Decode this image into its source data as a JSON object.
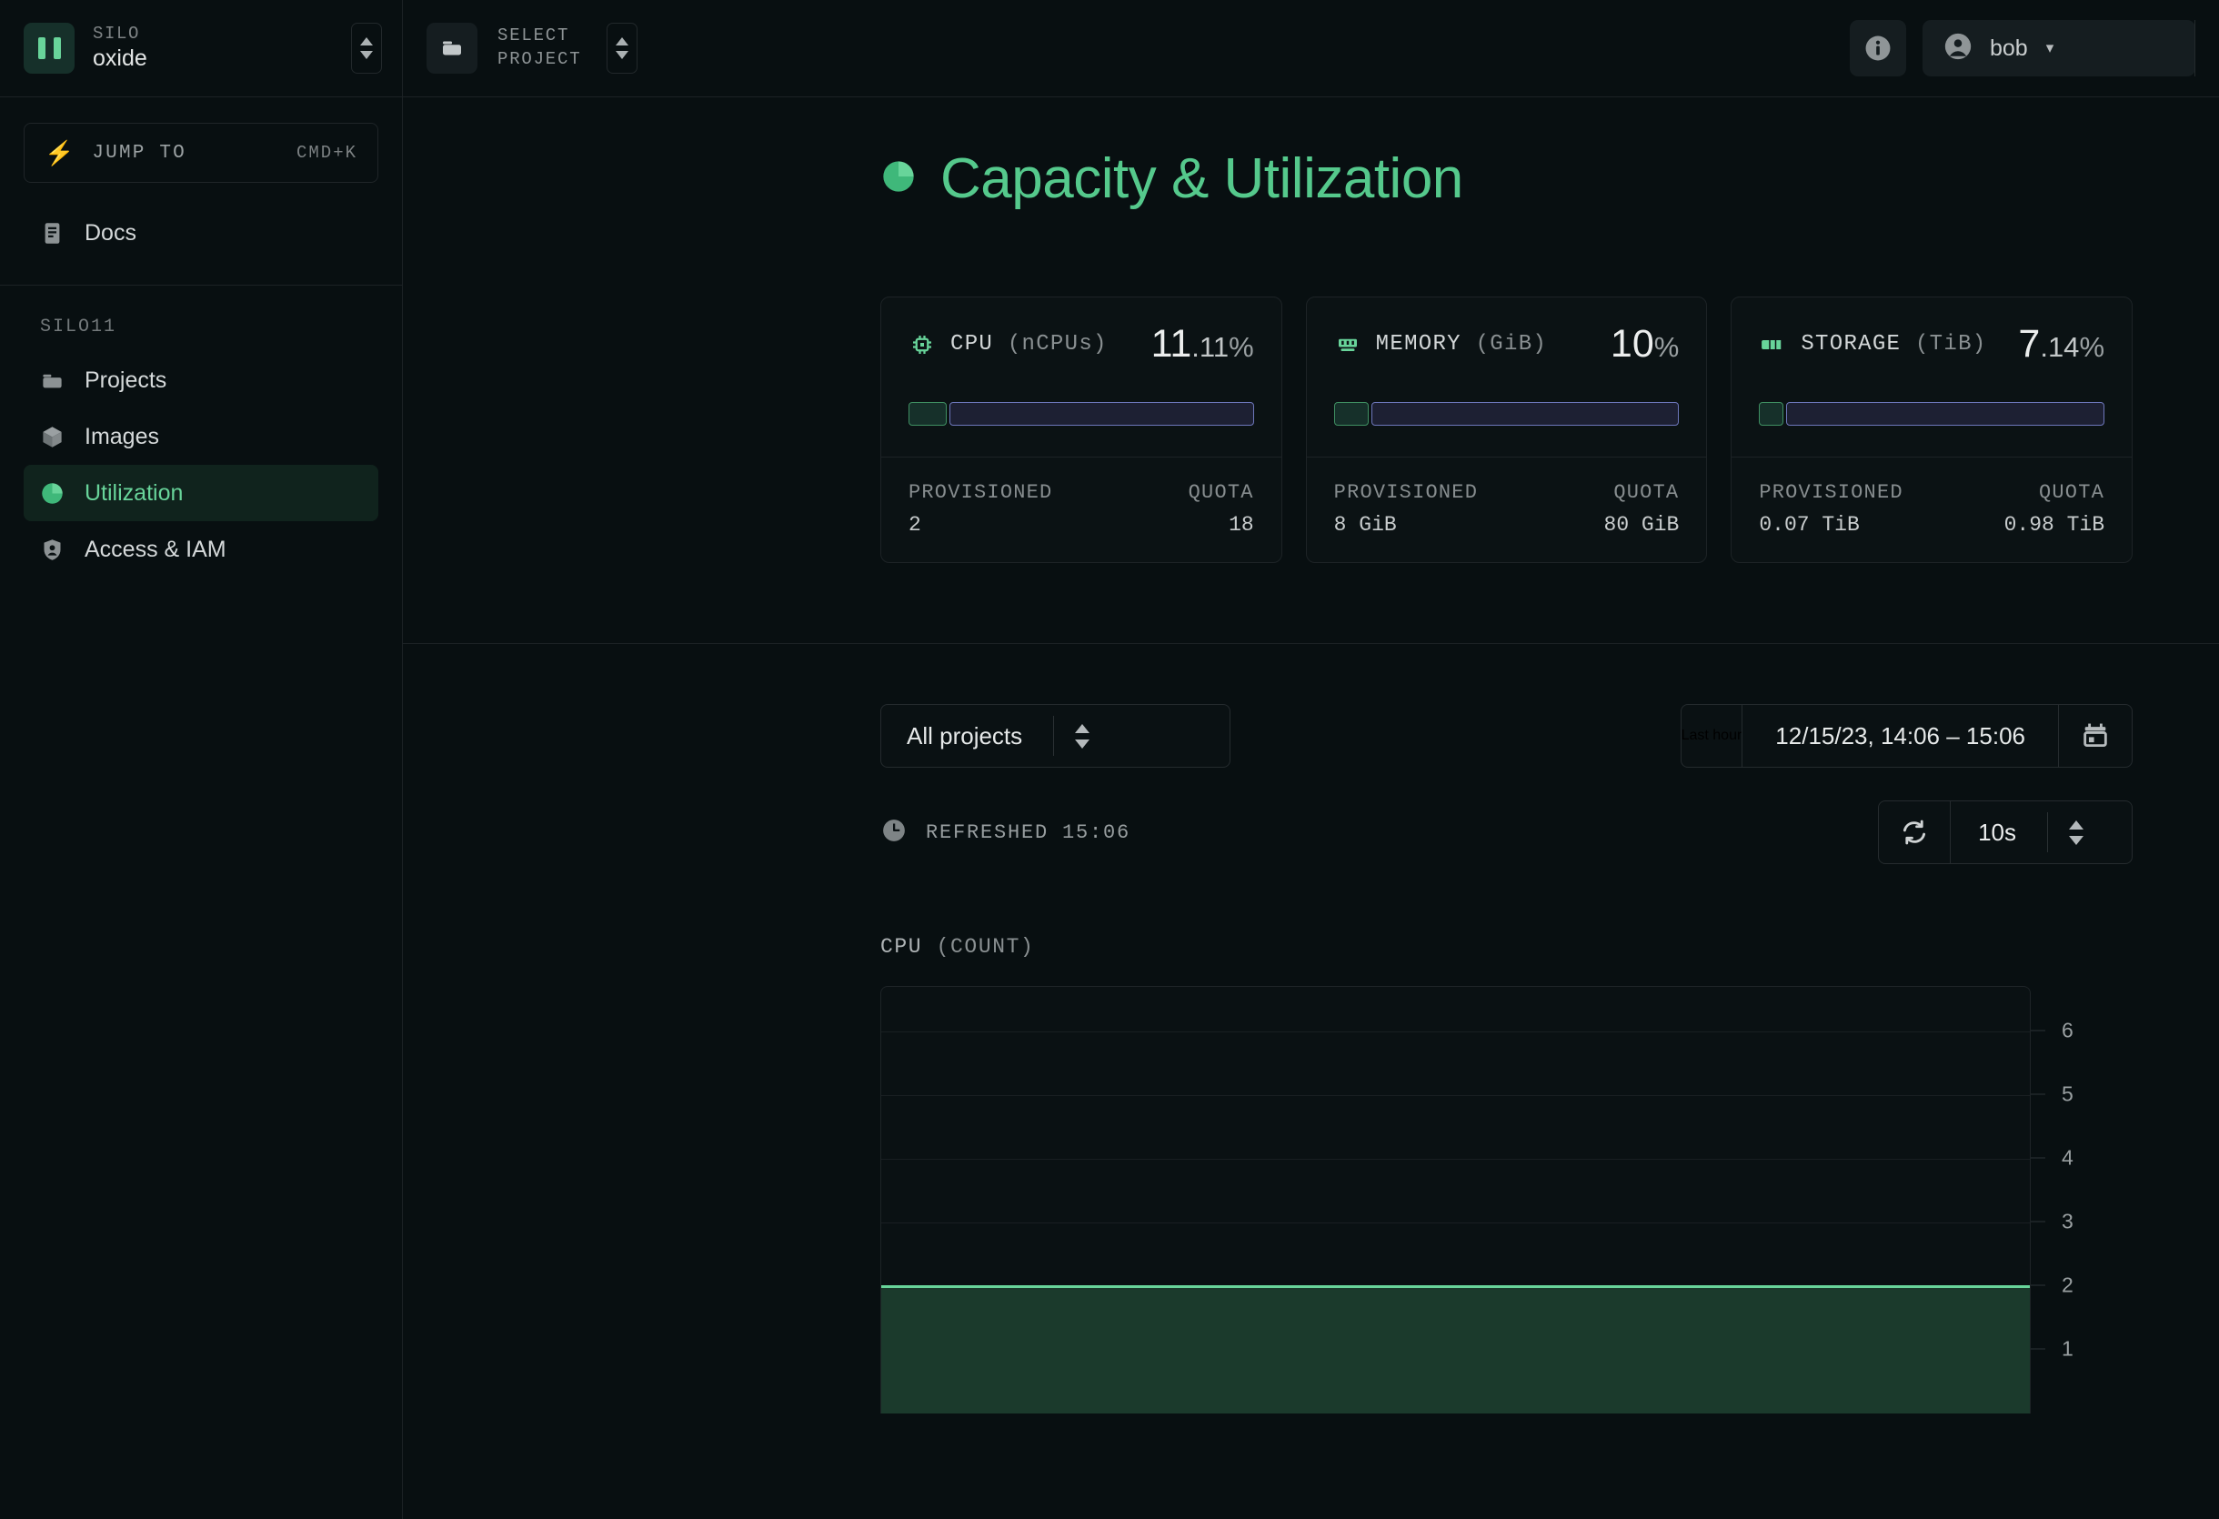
{
  "sidebar": {
    "silo": {
      "label": "SILO",
      "name": "oxide",
      "icon": "silo-badge-icon"
    },
    "jump": {
      "label": "JUMP TO",
      "shortcut": "CMD+K",
      "icon": "bolt-icon"
    },
    "top_items": [
      {
        "label": "Docs",
        "icon": "docs-icon",
        "active": false
      }
    ],
    "section_heading": "SILO11",
    "items": [
      {
        "label": "Projects",
        "icon": "folder-icon",
        "active": false
      },
      {
        "label": "Images",
        "icon": "cube-icon",
        "active": false
      },
      {
        "label": "Utilization",
        "icon": "pie-chart-icon",
        "active": true
      },
      {
        "label": "Access & IAM",
        "icon": "shield-person-icon",
        "active": false
      }
    ]
  },
  "topbar": {
    "project_selector": {
      "line1": "SELECT",
      "line2": "PROJECT",
      "icon": "folder-icon"
    },
    "info_icon": "info-icon",
    "user": {
      "name": "bob",
      "avatar_icon": "user-avatar-icon",
      "caret": "▾"
    }
  },
  "page": {
    "title": "Capacity & Utilization",
    "title_icon": "pie-chart-icon",
    "title_color": "#55c98c"
  },
  "cards": [
    {
      "name": "CPU",
      "unit": "(nCPUs)",
      "icon": "cpu-chip-icon",
      "pct_int": "11",
      "pct_frac": ".11",
      "pct_symbol": "%",
      "pct_value": 11.11,
      "provisioned_label": "PROVISIONED",
      "provisioned_value": "2",
      "quota_label": "QUOTA",
      "quota_value": "18"
    },
    {
      "name": "MEMORY",
      "unit": "(GiB)",
      "icon": "memory-icon",
      "pct_int": "10",
      "pct_frac": "",
      "pct_symbol": "%",
      "pct_value": 10,
      "provisioned_label": "PROVISIONED",
      "provisioned_value": "8 GiB",
      "quota_label": "QUOTA",
      "quota_value": "80 GiB"
    },
    {
      "name": "STORAGE",
      "unit": "(TiB)",
      "icon": "storage-icon",
      "pct_int": "7",
      "pct_frac": ".14",
      "pct_symbol": "%",
      "pct_value": 7.14,
      "provisioned_label": "PROVISIONED",
      "provisioned_value": "0.07 TiB",
      "quota_label": "QUOTA",
      "quota_value": "0.98 TiB"
    }
  ],
  "filters": {
    "project_select": {
      "value": "All projects"
    },
    "time_preset": {
      "value": "Last hour"
    },
    "time_range": {
      "value": "12/15/23, 14:06 – 15:06"
    },
    "calendar_icon": "calendar-icon",
    "refreshed": {
      "icon": "clock-icon",
      "text": "REFRESHED 15:06"
    },
    "refresh": {
      "icon": "refresh-icon",
      "interval": "10s"
    }
  },
  "chart_data": {
    "type": "area",
    "title": "CPU (COUNT)",
    "title_metric": "CPU",
    "title_unit": "(COUNT)",
    "xlabel": "",
    "ylabel": "",
    "ylim": [
      0,
      6.7
    ],
    "yticks": [
      1,
      2,
      3,
      4,
      5,
      6
    ],
    "grid": true,
    "legend": "none",
    "line_color": "#68d49a",
    "fill_color": "#1b3a2c",
    "series": [
      {
        "name": "CPU (count)",
        "values": [
          2,
          2,
          2,
          2,
          2,
          2,
          2,
          2,
          2,
          2,
          2,
          2
        ]
      }
    ],
    "x_range": "12/15/23, 14:06 – 15:06"
  }
}
